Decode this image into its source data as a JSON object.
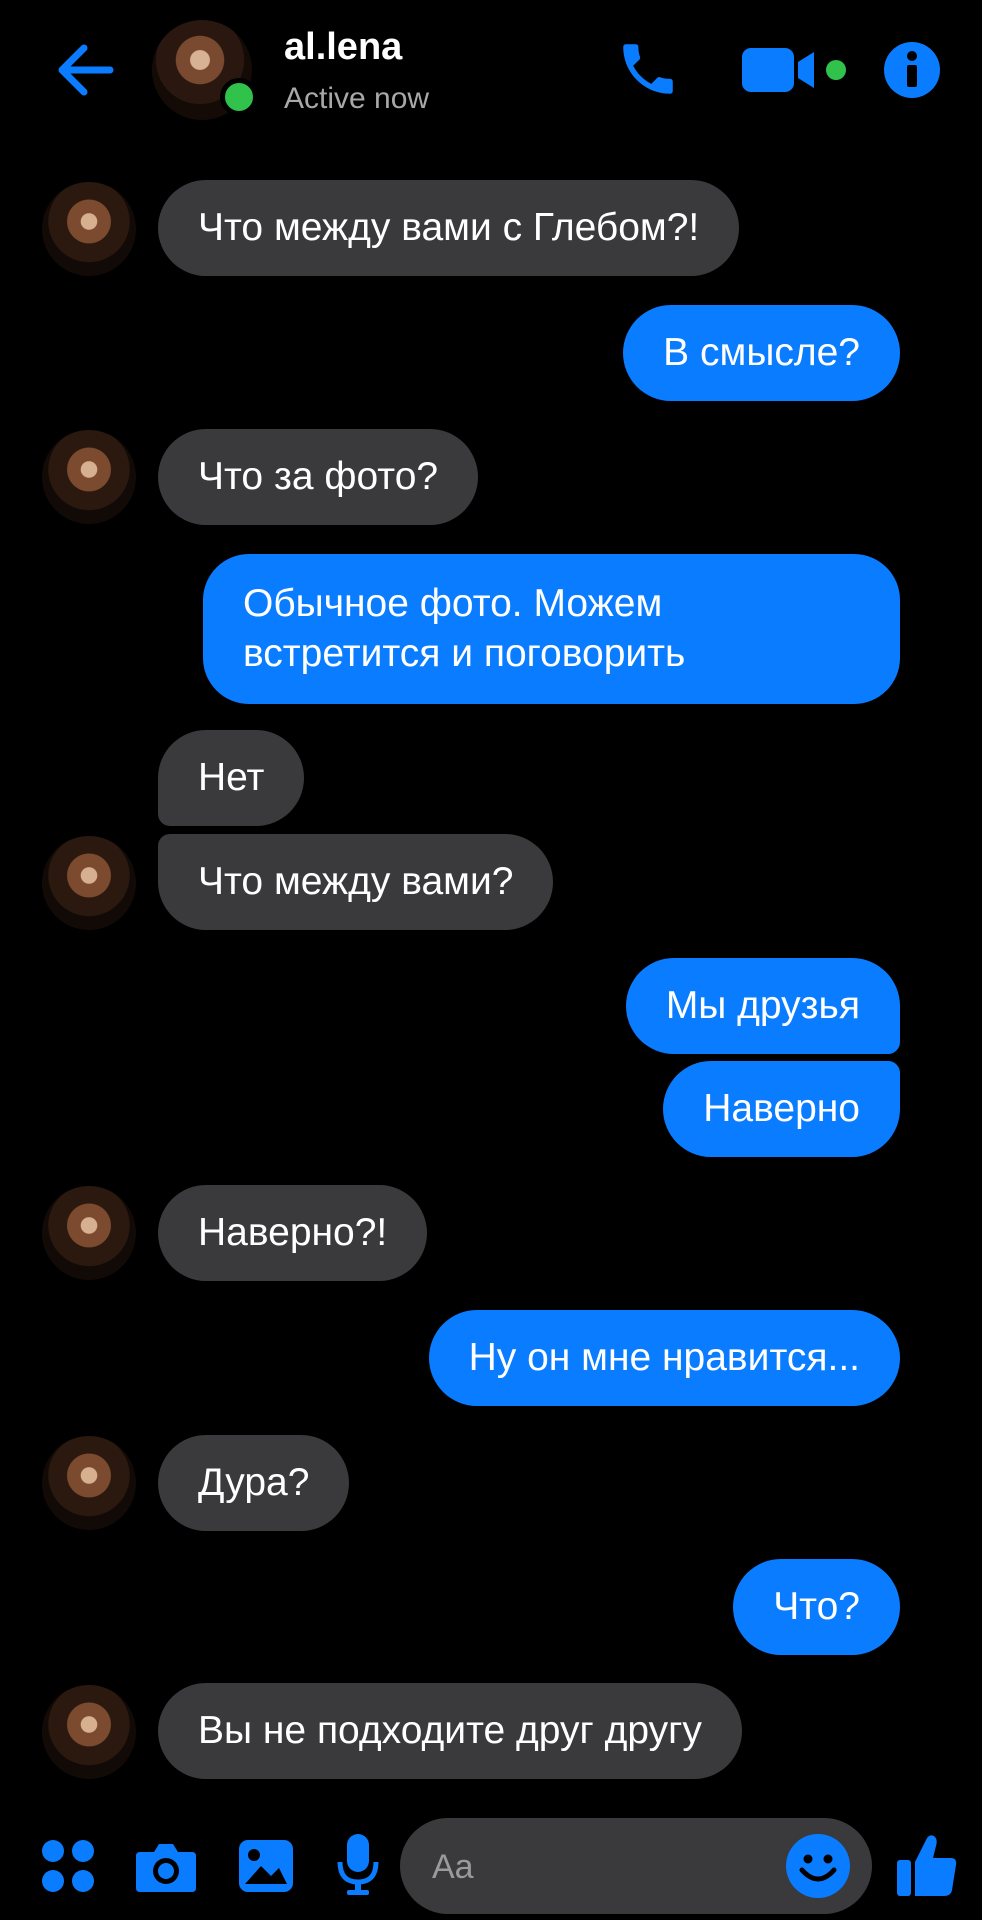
{
  "header": {
    "contact_name": "al.lena",
    "status": "Active now",
    "icons": [
      "back-arrow-icon",
      "phone-icon",
      "video-camera-icon",
      "info-icon"
    ]
  },
  "messages": [
    {
      "from": "them",
      "text": "Что между вами с Глебом?!"
    },
    {
      "from": "me",
      "text": "В смысле?"
    },
    {
      "from": "them",
      "text": "Что за фото?"
    },
    {
      "from": "me",
      "text": "Обычное фото. Можем встретится и поговорить"
    },
    {
      "from": "them",
      "text": "Нет"
    },
    {
      "from": "them",
      "text": "Что между вами?"
    },
    {
      "from": "me",
      "text": "Мы друзья"
    },
    {
      "from": "me",
      "text": "Наверно"
    },
    {
      "from": "them",
      "text": "Наверно?!"
    },
    {
      "from": "me",
      "text": "Ну он мне нравится..."
    },
    {
      "from": "them",
      "text": "Дура?"
    },
    {
      "from": "me",
      "text": "Что?"
    },
    {
      "from": "them",
      "text": "Вы не подходите друг другу"
    }
  ],
  "composer": {
    "placeholder": "Aa",
    "icons": [
      "apps-icon",
      "camera-icon",
      "gallery-icon",
      "microphone-icon",
      "emoji-icon",
      "thumbs-up-icon"
    ]
  },
  "colors": {
    "accent": "#0a7cff",
    "incoming_bubble": "#3a3a3c",
    "online": "#31c24b",
    "background": "#000000"
  }
}
